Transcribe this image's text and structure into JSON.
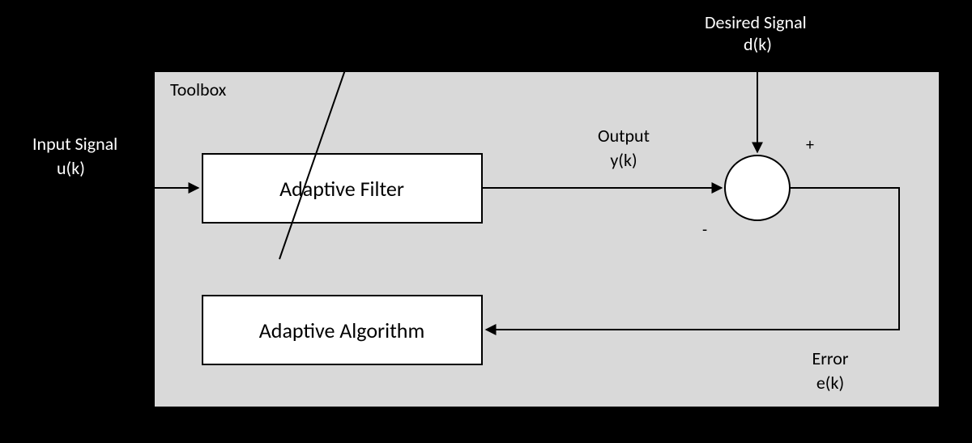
{
  "toolbox": {
    "title": "Toolbox"
  },
  "blocks": {
    "filter": {
      "label": "Adaptive Filter"
    },
    "algorithm": {
      "label": "Adaptive Algorithm"
    }
  },
  "signals": {
    "input": {
      "name": "Input Signal",
      "symbol": "u(k)"
    },
    "desired": {
      "name": "Desired Signal",
      "symbol": "d(k)"
    },
    "output": {
      "name": "Output",
      "symbol": "y(k)"
    },
    "error": {
      "name": "Error",
      "symbol": "e(k)"
    },
    "sum_plus": "+",
    "sum_minus": "-"
  }
}
